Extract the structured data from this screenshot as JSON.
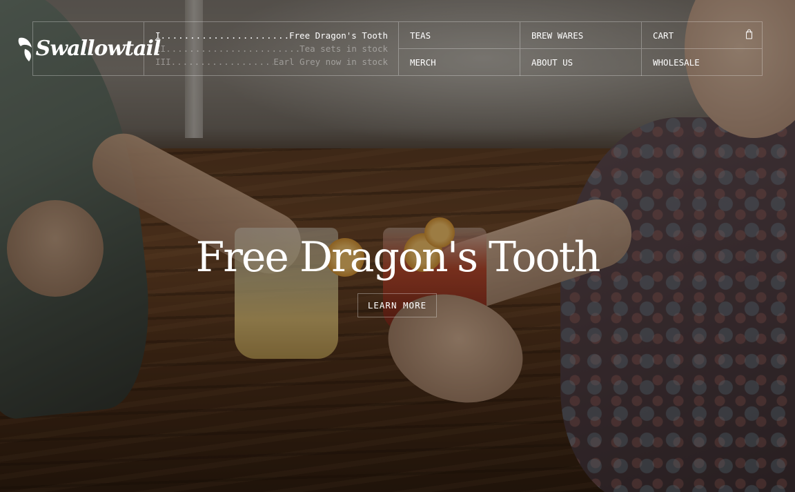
{
  "brand": {
    "logo_text": "Swallowtail"
  },
  "promos": [
    {
      "num": "I",
      "text": "Free Dragon's Tooth"
    },
    {
      "num": "II",
      "text": "Tea sets in stock"
    },
    {
      "num": "III",
      "text": "Earl Grey now in stock"
    }
  ],
  "nav": {
    "teas": "TEAS",
    "brew_wares": "BREW WARES",
    "cart": "CART",
    "merch": "MERCH",
    "about_us": "ABOUT US",
    "wholesale": "WHOLESALE"
  },
  "hero": {
    "title": "Free Dragon's Tooth",
    "cta": "LEARN MORE"
  }
}
